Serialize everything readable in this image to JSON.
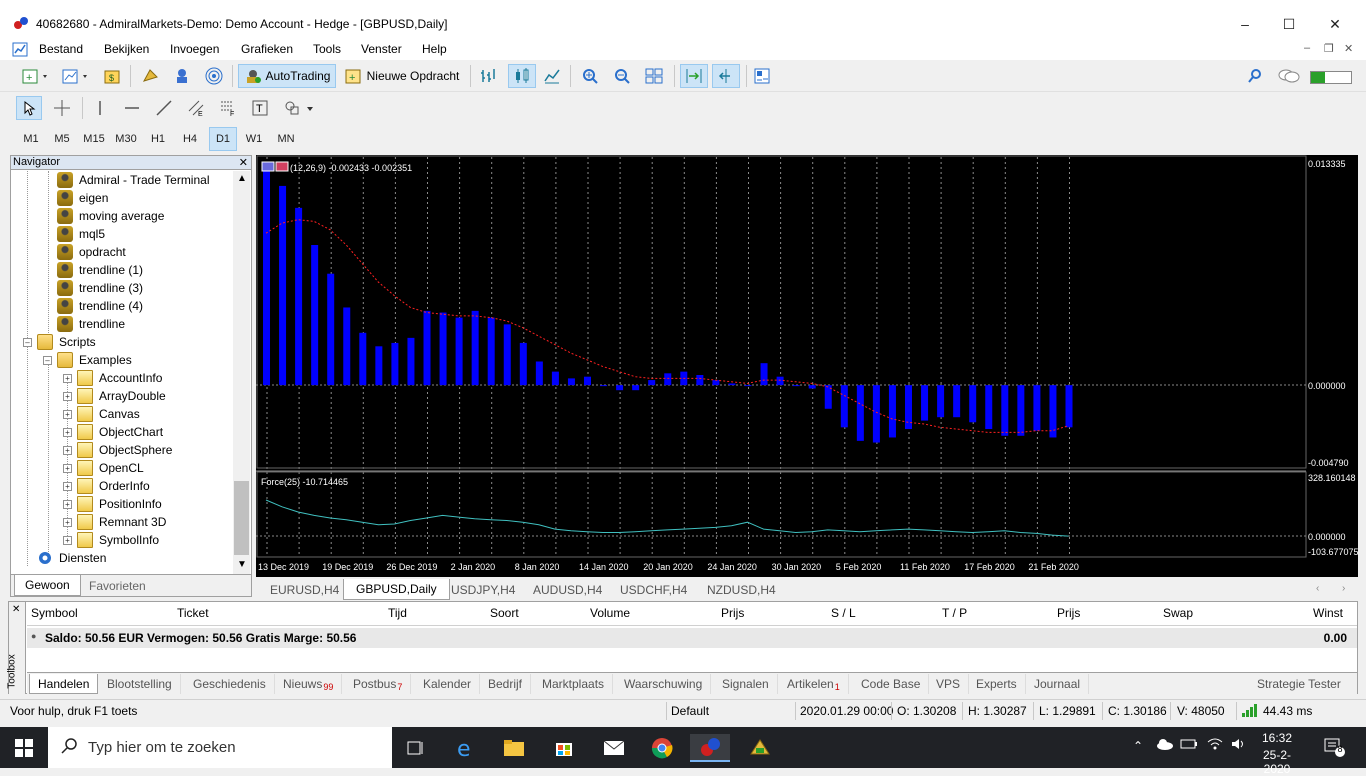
{
  "window": {
    "title": "40682680 - AdmiralMarkets-Demo: Demo Account - Hedge - [GBPUSD,Daily]",
    "minimize": "–",
    "maximize": "☐",
    "close": "✕"
  },
  "menu": [
    "Bestand",
    "Bekijken",
    "Invoegen",
    "Grafieken",
    "Tools",
    "Venster",
    "Help"
  ],
  "toolbar": {
    "autotrading_label": "AutoTrading",
    "new_order_label": "Nieuwe Opdracht"
  },
  "timeframes": [
    "M1",
    "M5",
    "M15",
    "M30",
    "H1",
    "H4",
    "D1",
    "W1",
    "MN"
  ],
  "active_timeframe": "D1",
  "navigator": {
    "title": "Navigator",
    "experts": [
      "Admiral - Trade Terminal",
      "eigen",
      "moving average",
      "mql5",
      "opdracht",
      "trendline (1)",
      "trendline (3)",
      "trendline (4)",
      "trendline"
    ],
    "scripts_label": "Scripts",
    "examples_label": "Examples",
    "examples": [
      "AccountInfo",
      "ArrayDouble",
      "Canvas",
      "ObjectChart",
      "ObjectSphere",
      "OpenCL",
      "OrderInfo",
      "PositionInfo",
      "Remnant 3D",
      "SymbolInfo"
    ],
    "services_label": "Diensten",
    "tabs": [
      "Gewoon",
      "Favorieten"
    ]
  },
  "chart": {
    "macd_label": "(12,26,9) -0.002433 -0.002351",
    "force_label": "Force(25) -10.714465",
    "macd_scale": [
      "0.013335",
      "0.000000",
      "-0.004790"
    ],
    "force_scale": [
      "328.160148",
      "0.000000",
      "-103.677075"
    ],
    "dates": [
      "13 Dec 2019",
      "19 Dec 2019",
      "26 Dec 2019",
      "2 Jan 2020",
      "8 Jan 2020",
      "14 Jan 2020",
      "20 Jan 2020",
      "24 Jan 2020",
      "30 Jan 2020",
      "5 Feb 2020",
      "11 Feb 2020",
      "17 Feb 2020",
      "21 Feb 2020"
    ],
    "bar_color": "#0000ff",
    "signal_color": "#ff2020",
    "force_color": "#40c0c0"
  },
  "chart_data": {
    "type": "bar",
    "macd_histogram": [
      0.013,
      0.0118,
      0.0105,
      0.0083,
      0.0066,
      0.0046,
      0.0031,
      0.0023,
      0.0025,
      0.0028,
      0.0044,
      0.0043,
      0.004,
      0.0044,
      0.004,
      0.0036,
      0.0025,
      0.0014,
      0.0008,
      0.0004,
      0.0005,
      0.0,
      -0.0003,
      -0.0003,
      0.0003,
      0.0007,
      0.0008,
      0.0006,
      0.0003,
      0.0001,
      0.0,
      0.0013,
      0.0005,
      0.0,
      -0.0002,
      -0.0014,
      -0.0025,
      -0.0033,
      -0.0034,
      -0.0031,
      -0.0026,
      -0.0021,
      -0.0019,
      -0.0019,
      -0.0022,
      -0.0026,
      -0.003,
      -0.003,
      -0.0027,
      -0.0031,
      -0.0025
    ],
    "macd_signal": [
      0.009,
      0.0096,
      0.0098,
      0.0097,
      0.0092,
      0.0083,
      0.0072,
      0.0061,
      0.0053,
      0.0046,
      0.0043,
      0.0042,
      0.0041,
      0.0041,
      0.004,
      0.0038,
      0.0034,
      0.0029,
      0.0024,
      0.0019,
      0.0015,
      0.0011,
      0.0008,
      0.0005,
      0.0004,
      0.0004,
      0.0004,
      0.0004,
      0.0003,
      0.0002,
      0.0001,
      0.0003,
      0.0003,
      0.0002,
      0.0001,
      -0.0001,
      -0.0006,
      -0.0011,
      -0.0016,
      -0.002,
      -0.0022,
      -0.0023,
      -0.0025,
      -0.0026,
      -0.0027,
      -0.0028,
      -0.0028,
      -0.0028,
      -0.0027,
      -0.0027,
      -0.0024
    ],
    "force_index": [
      200,
      160,
      130,
      110,
      95,
      85,
      70,
      55,
      60,
      80,
      95,
      110,
      100,
      90,
      85,
      80,
      70,
      55,
      30,
      20,
      15,
      10,
      10,
      15,
      20,
      25,
      30,
      35,
      40,
      50,
      70,
      30,
      20,
      10,
      15,
      25,
      20,
      15,
      20,
      25,
      30,
      25,
      20,
      15,
      10,
      15,
      20,
      10,
      5,
      -5,
      -10.71
    ],
    "ylim_macd": [
      -0.00479,
      0.013335
    ],
    "ylim_force": [
      -103.677075,
      328.160148
    ]
  },
  "chart_tabs": [
    "EURUSD,H4",
    "GBPUSD,Daily",
    "USDJPY,H4",
    "AUDUSD,H4",
    "USDCHF,H4",
    "NZDUSD,H4"
  ],
  "active_chart_tab": "GBPUSD,Daily",
  "toolbox": {
    "side_label": "Toolbox",
    "columns": [
      "Symbool",
      "Ticket",
      "Tijd",
      "Soort",
      "Volume",
      "Prijs",
      "S / L",
      "T / P",
      "Prijs",
      "Swap",
      "Winst"
    ],
    "balance_text": "Saldo: 50.56 EUR  Vermogen: 50.56  Gratis Marge: 50.56",
    "balance_value": "0.00",
    "tabs": [
      {
        "label": "Handelen",
        "badge": ""
      },
      {
        "label": "Blootstelling",
        "badge": ""
      },
      {
        "label": "Geschiedenis",
        "badge": ""
      },
      {
        "label": "Nieuws",
        "badge": "99"
      },
      {
        "label": "Postbus",
        "badge": "7"
      },
      {
        "label": "Kalender",
        "badge": ""
      },
      {
        "label": "Bedrijf",
        "badge": ""
      },
      {
        "label": "Marktplaats",
        "badge": ""
      },
      {
        "label": "Waarschuwing",
        "badge": ""
      },
      {
        "label": "Signalen",
        "badge": ""
      },
      {
        "label": "Artikelen",
        "badge": "1"
      },
      {
        "label": "Code Base",
        "badge": ""
      },
      {
        "label": "VPS",
        "badge": ""
      },
      {
        "label": "Experts",
        "badge": ""
      },
      {
        "label": "Journaal",
        "badge": ""
      }
    ],
    "strategy_tester": "Strategie Tester"
  },
  "status": {
    "help": "Voor hulp, druk F1 toets",
    "profile": "Default",
    "datetime": "2020.01.29 00:00",
    "open": "O: 1.30208",
    "high": "H: 1.30287",
    "low": "L: 1.29891",
    "close": "C: 1.30186",
    "volume": "V: 48050",
    "ping": "44.43 ms"
  },
  "taskbar": {
    "search_placeholder": "Typ hier om te zoeken",
    "time": "16:32",
    "date": "25-2-2020",
    "notifications": "8"
  }
}
